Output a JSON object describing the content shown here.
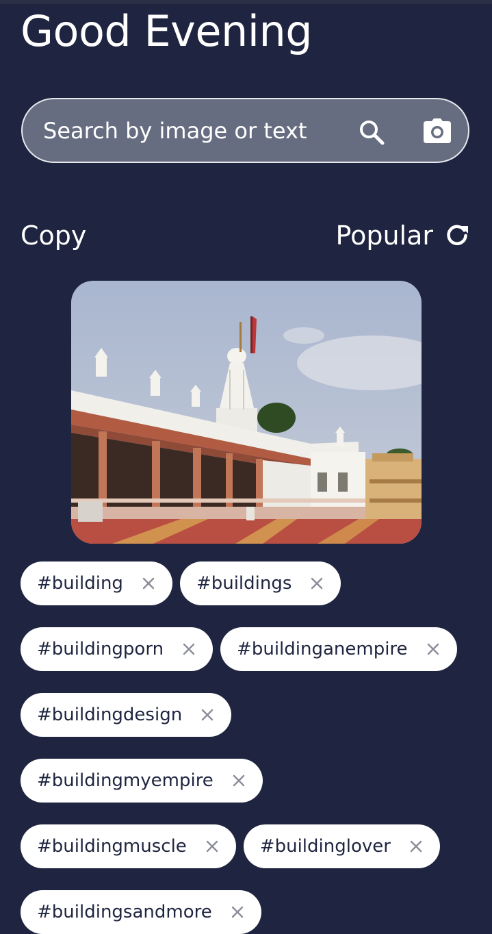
{
  "greeting": "Good Evening",
  "search": {
    "placeholder": "Search by image or text",
    "search_icon": "search-icon",
    "camera_icon": "camera-icon"
  },
  "actions": {
    "copy_label": "Copy",
    "popular_label": "Popular",
    "refresh_icon": "refresh-icon"
  },
  "preview": {
    "subject": "white temple with colonnade and red flag under blue sky"
  },
  "tags": [
    "#building",
    "#buildings",
    "#buildingporn",
    "#buildinganempire",
    "#buildingdesign",
    "#buildingmyempire",
    "#buildingmuscle",
    "#buildinglover",
    "#buildingsandmore"
  ],
  "colors": {
    "background": "#1f2540",
    "search_fill": "#676d80",
    "search_border": "#e7e9ef",
    "tag_fill": "#ffffff",
    "tag_text": "#1f2540",
    "tag_close": "#8a8d99"
  }
}
